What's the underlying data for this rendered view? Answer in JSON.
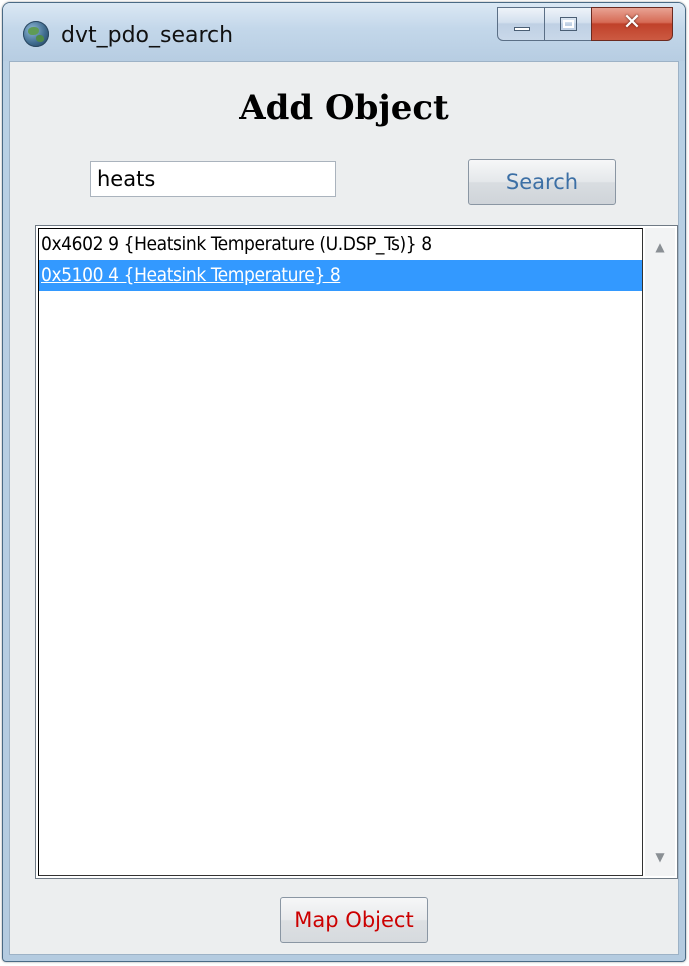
{
  "window": {
    "title": "dvt_pdo_search",
    "close_glyph": "✕"
  },
  "main": {
    "heading": "Add Object",
    "search_value": "heats",
    "search_button_label": "Search",
    "results": [
      {
        "text": "0x4602 9 {Heatsink Temperature (U.DSP_Ts)} 8",
        "selected": false
      },
      {
        "text": "0x5100 4 {Heatsink Temperature} 8",
        "selected": true
      }
    ],
    "scroll_up_glyph": "▲",
    "scroll_down_glyph": "▼",
    "map_button_label": "Map Object"
  },
  "colors": {
    "selection": "#3399ff",
    "search_label": "#3c6fa5",
    "map_label": "#cc0000"
  },
  "icons": {
    "app": "globe-icon",
    "minimize": "minimize-icon",
    "maximize": "maximize-icon",
    "close": "close-icon"
  }
}
